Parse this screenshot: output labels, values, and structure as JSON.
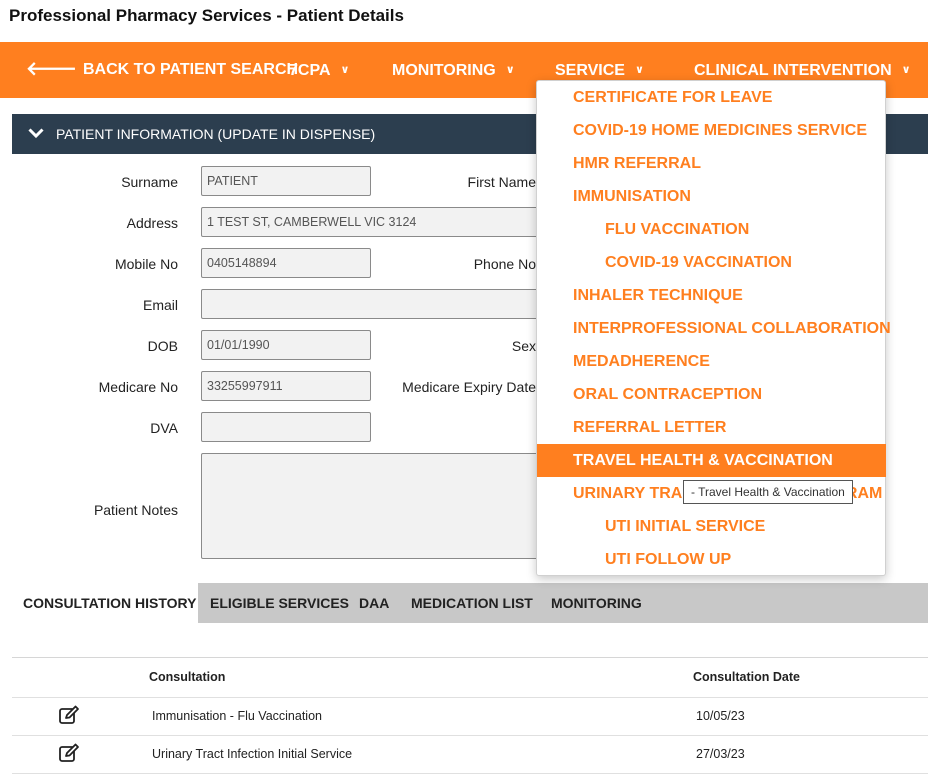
{
  "page": {
    "title": "Professional Pharmacy Services - Patient Details"
  },
  "nav": {
    "back": "BACK TO PATIENT SEARCH",
    "items": [
      "7CPA",
      "MONITORING",
      "SERVICE",
      "CLINICAL INTERVENTION"
    ]
  },
  "panel": {
    "title": "PATIENT INFORMATION (UPDATE IN DISPENSE)"
  },
  "form": {
    "surname_label": "Surname",
    "surname_value": "PATIENT",
    "firstname_label": "First Name",
    "address_label": "Address",
    "address_value": "1 TEST ST, CAMBERWELL VIC 3124",
    "mobile_label": "Mobile No",
    "mobile_value": "0405148894",
    "phone_label": "Phone No",
    "email_label": "Email",
    "email_value": "",
    "dob_label": "DOB",
    "dob_value": "01/01/1990",
    "sex_label": "Sex",
    "medicare_label": "Medicare No",
    "medicare_value": "33255997911",
    "medicare_expiry_label": "Medicare Expiry Date",
    "dva_label": "DVA",
    "dva_value": "",
    "notes_label": "Patient Notes"
  },
  "tabs": [
    "CONSULTATION HISTORY",
    "ELIGIBLE SERVICES",
    "DAA",
    "MEDICATION LIST",
    "MONITORING"
  ],
  "table": {
    "headers": [
      "Consultation",
      "Consultation Date"
    ],
    "rows": [
      {
        "consultation": "Immunisation - Flu Vaccination",
        "date": "10/05/23"
      },
      {
        "consultation": "Urinary Tract Infection Initial Service",
        "date": "27/03/23"
      }
    ]
  },
  "service_menu": {
    "items": [
      "CERTIFICATE FOR LEAVE",
      "COVID-19 HOME MEDICINES SERVICE",
      "HMR REFERRAL",
      "IMMUNISATION",
      "FLU VACCINATION",
      "COVID-19 VACCINATION",
      "INHALER TECHNIQUE",
      "INTERPROFESSIONAL COLLABORATION",
      "MEDADHERENCE",
      "ORAL CONTRACEPTION",
      "REFERRAL LETTER",
      "TRAVEL HEALTH & VACCINATION",
      "URINARY TRACT INFECTION PROGRAM",
      "UTI INITIAL SERVICE",
      "UTI FOLLOW UP"
    ],
    "tooltip": "- Travel Health & Vaccination"
  },
  "colors": {
    "accent": "#ff7f1f",
    "header_bg": "#2c3e4f",
    "tab_bar": "#c8c8c8"
  }
}
